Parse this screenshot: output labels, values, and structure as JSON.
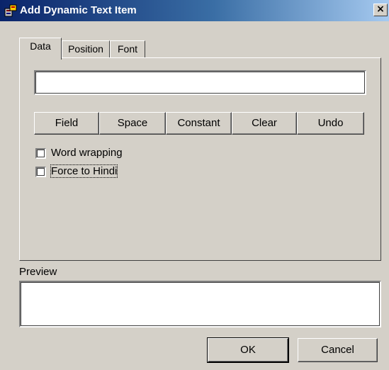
{
  "window": {
    "title": "Add Dynamic Text Item",
    "close_glyph": "×",
    "icon": "app-icon"
  },
  "tabs": [
    {
      "label": "Data",
      "active": true
    },
    {
      "label": "Position",
      "active": false
    },
    {
      "label": "Font",
      "active": false
    }
  ],
  "data_tab": {
    "text_value": "",
    "buttons": [
      "Field",
      "Space",
      "Constant",
      "Clear",
      "Undo"
    ],
    "checkboxes": [
      {
        "label": "Word wrapping",
        "checked": false
      },
      {
        "label": "Force to Hindi",
        "checked": false
      }
    ]
  },
  "preview": {
    "label": "Preview",
    "value": ""
  },
  "footer": {
    "ok_label": "OK",
    "cancel_label": "Cancel"
  },
  "colors": {
    "face": "#d4d0c8",
    "title_start": "#0a246a",
    "title_end": "#a6caf0"
  }
}
